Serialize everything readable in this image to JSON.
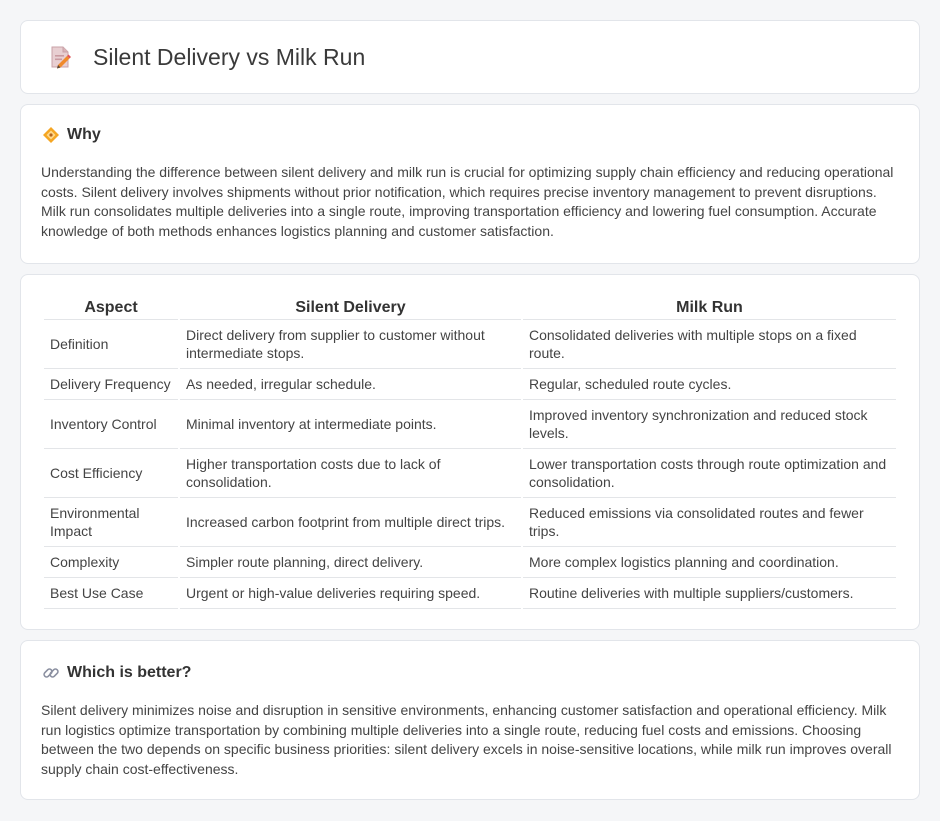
{
  "header": {
    "title": "Silent Delivery vs Milk Run",
    "icon": "document-pencil-icon"
  },
  "why": {
    "icon": "diamond-alert-icon",
    "title": "Why",
    "text": "Understanding the difference between silent delivery and milk run is crucial for optimizing supply chain efficiency and reducing operational costs. Silent delivery involves shipments without prior notification, which requires precise inventory management to prevent disruptions. Milk run consolidates multiple deliveries into a single route, improving transportation efficiency and lowering fuel consumption. Accurate knowledge of both methods enhances logistics planning and customer satisfaction."
  },
  "comparison": {
    "headers": [
      "Aspect",
      "Silent Delivery",
      "Milk Run"
    ],
    "rows": [
      [
        "Definition",
        "Direct delivery from supplier to customer without intermediate stops.",
        "Consolidated deliveries with multiple stops on a fixed route."
      ],
      [
        "Delivery Frequency",
        "As needed, irregular schedule.",
        "Regular, scheduled route cycles."
      ],
      [
        "Inventory Control",
        "Minimal inventory at intermediate points.",
        "Improved inventory synchronization and reduced stock levels."
      ],
      [
        "Cost Efficiency",
        "Higher transportation costs due to lack of consolidation.",
        "Lower transportation costs through route optimization and consolidation."
      ],
      [
        "Environmental Impact",
        "Increased carbon footprint from multiple direct trips.",
        "Reduced emissions via consolidated routes and fewer trips."
      ],
      [
        "Complexity",
        "Simpler route planning, direct delivery.",
        "More complex logistics planning and coordination."
      ],
      [
        "Best Use Case",
        "Urgent or high-value deliveries requiring speed.",
        "Routine deliveries with multiple suppliers/customers."
      ]
    ]
  },
  "better": {
    "icon": "link-icon",
    "title": "Which is better?",
    "text": "Silent delivery minimizes noise and disruption in sensitive environments, enhancing customer satisfaction and operational efficiency. Milk run logistics optimize transportation by combining multiple deliveries into a single route, reducing fuel costs and emissions. Choosing between the two depends on specific business priorities: silent delivery excels in noise-sensitive locations, while milk run improves overall supply chain cost-effectiveness."
  }
}
